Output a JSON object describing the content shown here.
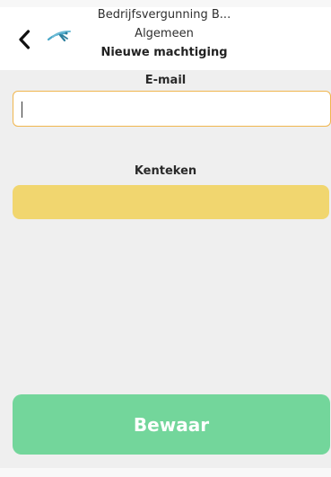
{
  "header": {
    "title_truncated": "Bedrijfsvergunning B...",
    "subtitle": "Algemeen",
    "screen_title": "Nieuwe machtiging",
    "back_icon": "chevron-left-icon",
    "logo_icon": "bird-logo-icon"
  },
  "form": {
    "email_label": "E-mail",
    "email_value": "",
    "kenteken_label": "Kenteken",
    "kenteken_value": ""
  },
  "actions": {
    "save_label": "Bewaar"
  },
  "colors": {
    "email_border": "#f0b64f",
    "kenteken_fill": "#f1d66f",
    "save_fill": "#73d69b",
    "content_bg": "#efefef"
  }
}
